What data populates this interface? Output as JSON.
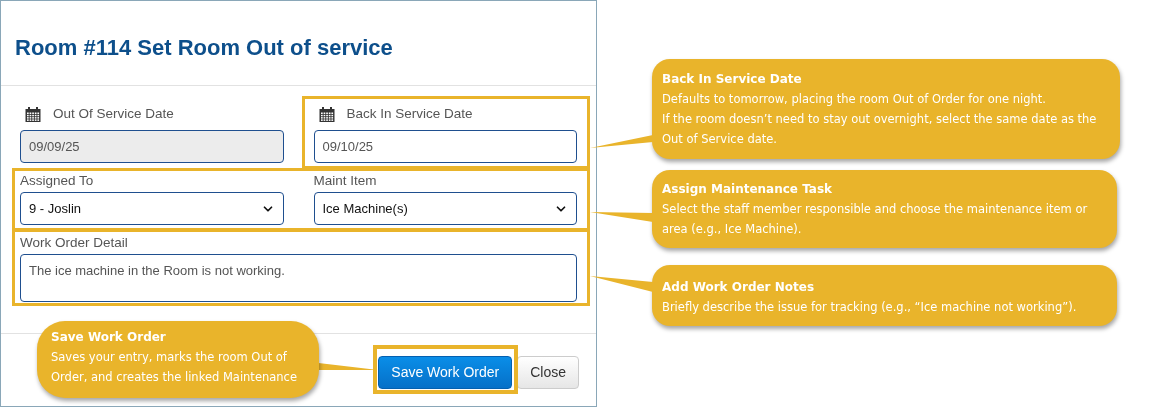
{
  "dialog": {
    "title": "Room #114 Set Room Out of service",
    "fields": [
      {
        "kind": "date",
        "label": "Out Of Service Date",
        "value": "09/09/25",
        "disabled": true
      },
      {
        "kind": "date",
        "label": "Back In Service Date",
        "value": "09/10/25",
        "disabled": false
      },
      {
        "kind": "select",
        "label": "Assigned To",
        "value": "9 - Joslin",
        "disabled": false
      },
      {
        "kind": "select",
        "label": "Maint Item",
        "value": "Ice Machine(s)",
        "disabled": false
      },
      {
        "kind": "textarea",
        "label": "Work Order Detail",
        "value": "The ice machine in the Room is not working.",
        "disabled": false
      }
    ],
    "buttons": [
      {
        "label": "Save Work Order",
        "kind": "primary"
      },
      {
        "label": "Close",
        "kind": "secondary"
      }
    ]
  },
  "callouts": [
    {
      "title": "Back In Service Date",
      "lines": [
        "Defaults to tomorrow, placing the room Out of Order for one night.",
        "If the room doesn’t need to stay out overnight, select the same date as the Out of Service date."
      ]
    },
    {
      "title": "Assign Maintenance Task",
      "lines": [
        "Select the staff member responsible and choose the maintenance item or area (e.g., Ice Machine)."
      ]
    },
    {
      "title": "Add Work Order Notes",
      "lines": [
        "Briefly describe the issue for tracking (e.g., “Ice machine not working”)."
      ]
    },
    {
      "title": "Save Work Order",
      "lines": [
        "Saves your entry, marks the room Out of Order, and creates the linked Maintenance"
      ]
    }
  ]
}
